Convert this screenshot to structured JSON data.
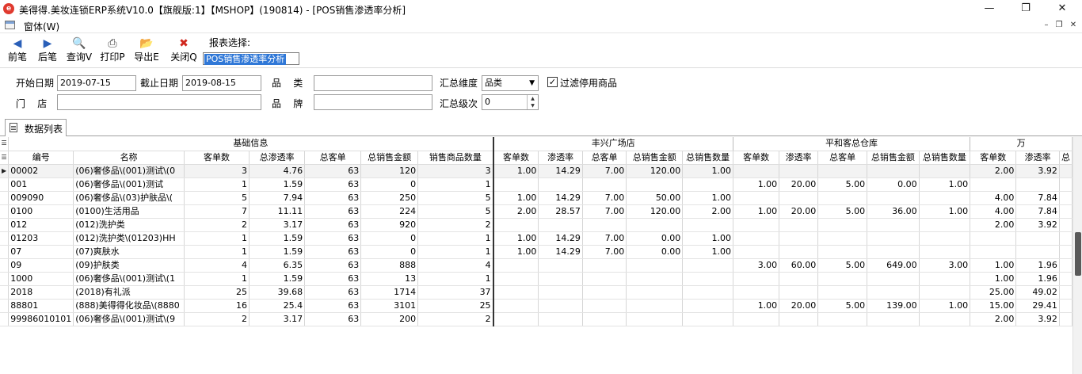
{
  "window": {
    "title": "美得得.美妆连锁ERP系统V10.0【旗舰版:1】【MSHOP】(190814) - [POS销售渗透率分析]",
    "app_icon": "app-logo-icon",
    "buttons": [
      "minimize-icon",
      "restore-icon",
      "close-icon"
    ]
  },
  "menubar": {
    "window_menu": "窗体(W)"
  },
  "toolbar": {
    "buttons": [
      {
        "label": "前笔",
        "icon": "arrow-left-icon"
      },
      {
        "label": "后笔",
        "icon": "arrow-right-icon"
      },
      {
        "label": "查询V",
        "icon": "query-icon"
      },
      {
        "label": "打印P",
        "icon": "print-icon"
      },
      {
        "label": "导出E",
        "icon": "export-icon"
      },
      {
        "label": "关闭Q",
        "icon": "close-icon"
      }
    ],
    "report_label": "报表选择:",
    "report_value": "POS销售渗透率分析"
  },
  "filters": {
    "start_date_label": "开始日期",
    "start_date": "2019-07-15",
    "end_date_label": "截止日期",
    "end_date": "2019-08-15",
    "category_label": "品    类",
    "category": "",
    "summary_dim_label": "汇总维度",
    "summary_dim": "品类",
    "filter_disabled_label": "过滤停用商品",
    "filter_disabled_checked": true,
    "store_label": "门    店",
    "store": "",
    "brand_label": "品    牌",
    "brand": "",
    "summary_level_label": "汇总级次",
    "summary_level": "0"
  },
  "tab": {
    "label": "数据列表"
  },
  "grid": {
    "groups": [
      "基础信息",
      "丰兴广场店",
      "平和客总仓库",
      "万"
    ],
    "columns": {
      "base": [
        "编号",
        "名称",
        "客单数",
        "总渗透率",
        "总客单",
        "总销售金额",
        "销售商品数量"
      ],
      "store1": [
        "客单数",
        "渗透率",
        "总客单",
        "总销售金额",
        "总销售数量"
      ],
      "store2": [
        "客单数",
        "渗透率",
        "总客单",
        "总销售金额",
        "总销售数量"
      ],
      "store3": [
        "客单数",
        "渗透率",
        "总"
      ]
    },
    "rows": [
      {
        "code": "00002",
        "name": "(06)奢侈品\\(001)测试\\(0",
        "orders": "3",
        "rate": "4.76",
        "total_orders": "63",
        "amount": "120",
        "qty": "3",
        "s1": [
          "1.00",
          "14.29",
          "7.00",
          "120.00",
          "1.00"
        ],
        "s2": [
          "",
          "",
          "",
          "",
          ""
        ],
        "s3": [
          "2.00",
          "3.92"
        ]
      },
      {
        "code": "001",
        "name": "(06)奢侈品\\(001)测试",
        "orders": "1",
        "rate": "1.59",
        "total_orders": "63",
        "amount": "0",
        "qty": "1",
        "s1": [
          "",
          "",
          "",
          "",
          ""
        ],
        "s2": [
          "1.00",
          "20.00",
          "5.00",
          "0.00",
          "1.00"
        ],
        "s3": [
          "",
          ""
        ]
      },
      {
        "code": "009090",
        "name": "(06)奢侈品\\(03)护肤品\\(",
        "orders": "5",
        "rate": "7.94",
        "total_orders": "63",
        "amount": "250",
        "qty": "5",
        "s1": [
          "1.00",
          "14.29",
          "7.00",
          "50.00",
          "1.00"
        ],
        "s2": [
          "",
          "",
          "",
          "",
          ""
        ],
        "s3": [
          "4.00",
          "7.84"
        ]
      },
      {
        "code": "0100",
        "name": "(0100)生活用品",
        "orders": "7",
        "rate": "11.11",
        "total_orders": "63",
        "amount": "224",
        "qty": "5",
        "s1": [
          "2.00",
          "28.57",
          "7.00",
          "120.00",
          "2.00"
        ],
        "s2": [
          "1.00",
          "20.00",
          "5.00",
          "36.00",
          "1.00"
        ],
        "s3": [
          "4.00",
          "7.84"
        ]
      },
      {
        "code": "012",
        "name": "(012)洗护类",
        "orders": "2",
        "rate": "3.17",
        "total_orders": "63",
        "amount": "920",
        "qty": "2",
        "s1": [
          "",
          "",
          "",
          "",
          ""
        ],
        "s2": [
          "",
          "",
          "",
          "",
          ""
        ],
        "s3": [
          "2.00",
          "3.92"
        ]
      },
      {
        "code": "01203",
        "name": "(012)洗护类\\(01203)HH",
        "orders": "1",
        "rate": "1.59",
        "total_orders": "63",
        "amount": "0",
        "qty": "1",
        "s1": [
          "1.00",
          "14.29",
          "7.00",
          "0.00",
          "1.00"
        ],
        "s2": [
          "",
          "",
          "",
          "",
          ""
        ],
        "s3": [
          "",
          ""
        ]
      },
      {
        "code": "07",
        "name": "(07)爽肤水",
        "orders": "1",
        "rate": "1.59",
        "total_orders": "63",
        "amount": "0",
        "qty": "1",
        "s1": [
          "1.00",
          "14.29",
          "7.00",
          "0.00",
          "1.00"
        ],
        "s2": [
          "",
          "",
          "",
          "",
          ""
        ],
        "s3": [
          "",
          ""
        ]
      },
      {
        "code": "09",
        "name": "(09)护肤类",
        "orders": "4",
        "rate": "6.35",
        "total_orders": "63",
        "amount": "888",
        "qty": "4",
        "s1": [
          "",
          "",
          "",
          "",
          ""
        ],
        "s2": [
          "3.00",
          "60.00",
          "5.00",
          "649.00",
          "3.00"
        ],
        "s3": [
          "1.00",
          "1.96"
        ]
      },
      {
        "code": "1000",
        "name": "(06)奢侈品\\(001)测试\\(1",
        "orders": "1",
        "rate": "1.59",
        "total_orders": "63",
        "amount": "13",
        "qty": "1",
        "s1": [
          "",
          "",
          "",
          "",
          ""
        ],
        "s2": [
          "",
          "",
          "",
          "",
          ""
        ],
        "s3": [
          "1.00",
          "1.96"
        ]
      },
      {
        "code": "2018",
        "name": "(2018)有礼派",
        "orders": "25",
        "rate": "39.68",
        "total_orders": "63",
        "amount": "1714",
        "qty": "37",
        "s1": [
          "",
          "",
          "",
          "",
          ""
        ],
        "s2": [
          "",
          "",
          "",
          "",
          ""
        ],
        "s3": [
          "25.00",
          "49.02"
        ]
      },
      {
        "code": "88801",
        "name": "(888)美得得化妆品\\(8880",
        "orders": "16",
        "rate": "25.4",
        "total_orders": "63",
        "amount": "3101",
        "qty": "25",
        "s1": [
          "",
          "",
          "",
          "",
          ""
        ],
        "s2": [
          "1.00",
          "20.00",
          "5.00",
          "139.00",
          "1.00"
        ],
        "s3": [
          "15.00",
          "29.41"
        ]
      },
      {
        "code": "99986010101",
        "name": "(06)奢侈品\\(001)测试\\(9",
        "orders": "2",
        "rate": "3.17",
        "total_orders": "63",
        "amount": "200",
        "qty": "2",
        "s1": [
          "",
          "",
          "",
          "",
          ""
        ],
        "s2": [
          "",
          "",
          "",
          "",
          ""
        ],
        "s3": [
          "2.00",
          "3.92"
        ]
      }
    ]
  }
}
